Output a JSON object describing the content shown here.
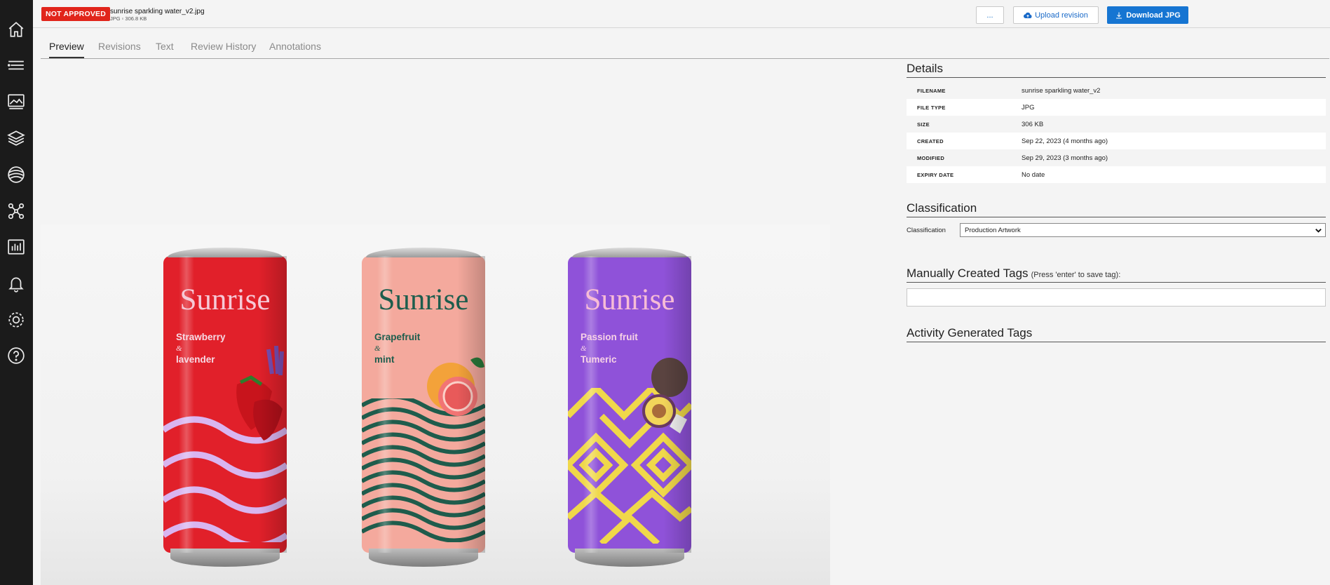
{
  "status_badge": "NOT APPROVED",
  "file": {
    "title": "sunrise sparkling water_v2.jpg",
    "meta": "JPG ▫ 306.8 KB"
  },
  "actions": {
    "more": "...",
    "upload": "Upload revision",
    "download": "Download JPG"
  },
  "sidebar": {
    "items": [
      {
        "icon": "home-icon"
      },
      {
        "icon": "list-icon"
      },
      {
        "icon": "image-gallery-icon"
      },
      {
        "icon": "layers-icon"
      },
      {
        "icon": "globe-icon"
      },
      {
        "icon": "workflow-icon"
      },
      {
        "icon": "bar-chart-icon"
      },
      {
        "icon": "bell-icon"
      },
      {
        "icon": "gear-icon"
      },
      {
        "icon": "help-icon"
      }
    ]
  },
  "tabs": [
    {
      "label": "Preview",
      "active": true
    },
    {
      "label": "Revisions"
    },
    {
      "label": "Text"
    },
    {
      "label": "Review History"
    },
    {
      "label": "Annotations"
    }
  ],
  "preview": {
    "cans": [
      {
        "brand": "Sunrise",
        "flavor1": "Strawberry",
        "amp": "&",
        "flavor2": "lavender",
        "color": "#e1202a"
      },
      {
        "brand": "Sunrise",
        "flavor1": "Grapefruit",
        "amp": "&",
        "flavor2": "mint",
        "color": "#f4a99d"
      },
      {
        "brand": "Sunrise",
        "flavor1": "Passion fruit",
        "amp": "&",
        "flavor2": "Tumeric",
        "color": "#8f52d9"
      }
    ]
  },
  "details": {
    "title": "Details",
    "rows": [
      {
        "label": "FILENAME",
        "value": "sunrise sparkling water_v2"
      },
      {
        "label": "FILE TYPE",
        "value": "JPG"
      },
      {
        "label": "SIZE",
        "value": "306 KB"
      },
      {
        "label": "CREATED",
        "value": "Sep 22, 2023 (4 months ago)"
      },
      {
        "label": "MODIFIED",
        "value": "Sep 29, 2023 (3 months ago)"
      },
      {
        "label": "EXPIRY DATE",
        "value": "No date"
      }
    ]
  },
  "classification": {
    "title": "Classification",
    "label": "Classification",
    "selected": "Production Artwork"
  },
  "manual_tags": {
    "title": "Manually Created Tags",
    "hint": "(Press 'enter' to save tag):",
    "value": ""
  },
  "activity_tags": {
    "title": "Activity Generated Tags"
  },
  "colors": {
    "badge": "#e1251b",
    "primary": "#1675d2",
    "sidebar": "#1b1b1b"
  }
}
